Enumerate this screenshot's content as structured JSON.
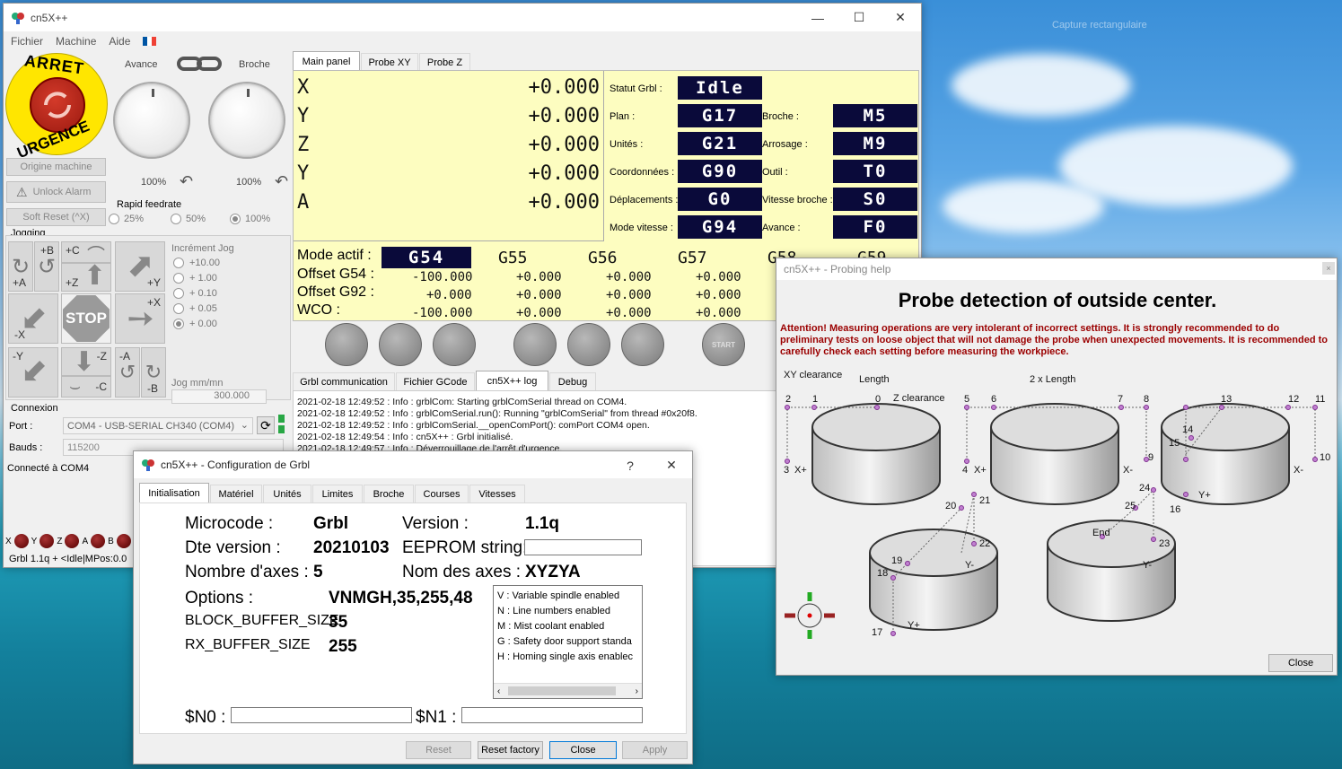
{
  "desktop": {
    "snip_label": "Capture rectangulaire"
  },
  "main_window": {
    "title": "cn5X++",
    "menu": [
      "Fichier",
      "Machine",
      "Aide"
    ],
    "estop": {
      "top": "ARRET",
      "bottom": "URGENCE"
    },
    "avance_label": "Avance",
    "broche_label": "Broche",
    "avance_pct": "100%",
    "broche_pct": "100%",
    "origine_btn": "Origine machine",
    "unlock_btn": "Unlock Alarm",
    "softreset_btn": "Soft Reset (^X)",
    "rapid_feedrate_label": "Rapid feedrate",
    "rapid_options": [
      "25%",
      "50%",
      "100%"
    ],
    "jogging_label": "Jogging",
    "jog_labels": {
      "b_plus": "+B",
      "c_plus": "+C",
      "a_plus": "+A",
      "z_plus": "+Z",
      "y_plus": "+Y",
      "x_plus": "+X",
      "x_minus": "-X",
      "stop": "STOP",
      "y_minus": "-Y",
      "z_minus": "-Z",
      "a_minus": "-A",
      "c_minus": "-C",
      "b_minus": "-B"
    },
    "increment_label": "Incrément Jog",
    "increments": [
      "+10.00",
      "+ 1.00",
      "+ 0.10",
      "+ 0.05",
      "+ 0.00"
    ],
    "jog_speed_label": "Jog mm/mn",
    "jog_speed": "300.000",
    "connexion_label": "Connexion",
    "port_label": "Port :",
    "port_value": "COM4 - USB-SERIAL CH340 (COM4)",
    "bauds_label": "Bauds :",
    "bauds_value": "115200",
    "connected": "Connecté à COM4",
    "axis_leds": [
      "X",
      "Y",
      "Z",
      "A",
      "B"
    ],
    "status_line": "Grbl 1.1q  + <Idle|MPos:0.0",
    "tabs": [
      "Main panel",
      "Probe XY",
      "Probe Z"
    ],
    "axes": [
      {
        "name": "X",
        "value": "+0.000"
      },
      {
        "name": "Y",
        "value": "+0.000"
      },
      {
        "name": "Z",
        "value": "+0.000"
      },
      {
        "name": "Y",
        "value": "+0.000"
      },
      {
        "name": "A",
        "value": "+0.000"
      }
    ],
    "status": {
      "statut_label": "Statut Grbl :",
      "statut": "Idle",
      "plan_label": "Plan :",
      "plan": "G17",
      "unites_label": "Unités :",
      "unites": "G21",
      "coord_label": "Coordonnées :",
      "coord": "G90",
      "depl_label": "Déplacements :",
      "depl": "G0",
      "mode_label": "Mode vitesse :",
      "mode": "G94",
      "broche_label": "Broche :",
      "broche": "M5",
      "arrosage_label": "Arrosage :",
      "arrosage": "M9",
      "outil_label": "Outil :",
      "outil": "T0",
      "vitesse_label": "Vitesse broche :",
      "vitesse": "S0",
      "avance_label": "Avance :",
      "avance": "F0"
    },
    "mode_actif_label": "Mode actif :",
    "work_systems": [
      "G54",
      "G55",
      "G56",
      "G57",
      "G58",
      "G59"
    ],
    "offset_g54_label": "Offset G54 :",
    "offset_g92_label": "Offset G92 :",
    "wco_label": "WCO :",
    "offset_g54": [
      "-100.000",
      "+0.000",
      "+0.000",
      "+0.000"
    ],
    "offset_g92": [
      "+0.000",
      "+0.000",
      "+0.000",
      "+0.000"
    ],
    "wco": [
      "-100.000",
      "+0.000",
      "+0.000",
      "+0.000"
    ],
    "start_label": "START",
    "log_tabs": [
      "Grbl communication",
      "Fichier GCode",
      "cn5X++ log",
      "Debug"
    ],
    "log_lines": [
      "2021-02-18 12:49:52 : Info    : grblCom: Starting grblComSerial thread on COM4.",
      "2021-02-18 12:49:52 : Info    : grblComSerial.run(): Running \"grblComSerial\" from thread #0x20f8.",
      "2021-02-18 12:49:52 : Info    : grblComSerial.__openComPort(): comPort COM4 open.",
      "2021-02-18 12:49:54 : Info    : cn5X++ : Grbl initialisé.",
      "2021-02-18 12:49:57 : Info    : Déverrouillage de l'arrêt d'urgence."
    ]
  },
  "probe_window": {
    "title": "cn5X++ - Probing help",
    "heading": "Probe detection of outside center.",
    "warning": "Attention! Measuring operations are very intolerant of incorrect settings. It is strongly recommended to do preliminary tests on loose object that will not damage the probe when unexpected movements. It is recommended to carefully check each setting before measuring the workpiece.",
    "labels": {
      "xy_clearance": "XY clearance",
      "length": "Length",
      "z_clearance": "Z clearance",
      "two_length": "2 x Length",
      "end": "End"
    },
    "points": [
      "1",
      "2",
      "3",
      "4",
      "5",
      "6",
      "7",
      "8",
      "9",
      "10",
      "11",
      "12",
      "13",
      "14",
      "15",
      "16",
      "17",
      "18",
      "19",
      "20",
      "21",
      "22",
      "23",
      "24",
      "25",
      "0"
    ],
    "axis_marks": {
      "xp": "X+",
      "xm": "X-",
      "yp": "Y+",
      "ym": "Y-"
    },
    "close_btn": "Close"
  },
  "config_window": {
    "title": "cn5X++ - Configuration de Grbl",
    "help": "?",
    "tabs": [
      "Initialisation",
      "Matériel",
      "Unités",
      "Limites",
      "Broche",
      "Courses",
      "Vitesses"
    ],
    "microcode_label": "Microcode :",
    "microcode": "Grbl",
    "version_label": "Version :",
    "version": "1.1q",
    "dte_label": "Dte version :",
    "dte": "20210103",
    "eeprom_label": "EEPROM string:",
    "axes_count_label": "Nombre d'axes :",
    "axes_count": "5",
    "axes_names_label": "Nom des axes :",
    "axes_names": "XYZYA",
    "options_label": "Options :",
    "options": "VNMGH,35,255,48",
    "block_label": "BLOCK_BUFFER_SIZE",
    "block": "35",
    "rx_label": "RX_BUFFER_SIZE",
    "rx": "255",
    "option_list": [
      "V : Variable spindle enabled",
      "N : Line numbers enabled",
      "M : Mist coolant enabled",
      "G : Safety door support standa",
      "H : Homing single axis enablec"
    ],
    "n0_label": "$N0 :",
    "n1_label": "$N1 :",
    "buttons": {
      "reset": "Reset",
      "reset_factory": "Reset factory",
      "close": "Close",
      "apply": "Apply"
    }
  }
}
